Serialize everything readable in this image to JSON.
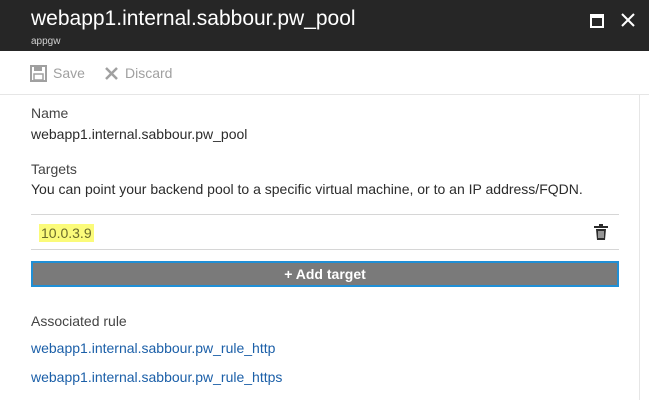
{
  "header": {
    "title": "webapp1.internal.sabbour.pw_pool",
    "subtitle": "appgw"
  },
  "toolbar": {
    "save_label": "Save",
    "discard_label": "Discard"
  },
  "form": {
    "name_label": "Name",
    "name_value": "webapp1.internal.sabbour.pw_pool",
    "targets_label": "Targets",
    "targets_description": "You can point your backend pool to a specific virtual machine, or to an IP address/FQDN.",
    "target_value": "10.0.3.9",
    "add_target_label": "+ Add target",
    "associated_rule_label": "Associated rule",
    "rules": [
      "webapp1.internal.sabbour.pw_rule_http",
      "webapp1.internal.sabbour.pw_rule_https"
    ]
  },
  "icons": {
    "save": "save-icon",
    "discard": "close-icon",
    "maximize": "maximize-icon",
    "close": "close-icon",
    "delete": "trash-icon"
  },
  "colors": {
    "header_bg": "#262626",
    "link": "#1b5fa8",
    "highlight": "#fbfb7a",
    "button_bg": "#7a7a7a",
    "button_border": "#1f8fd6"
  }
}
